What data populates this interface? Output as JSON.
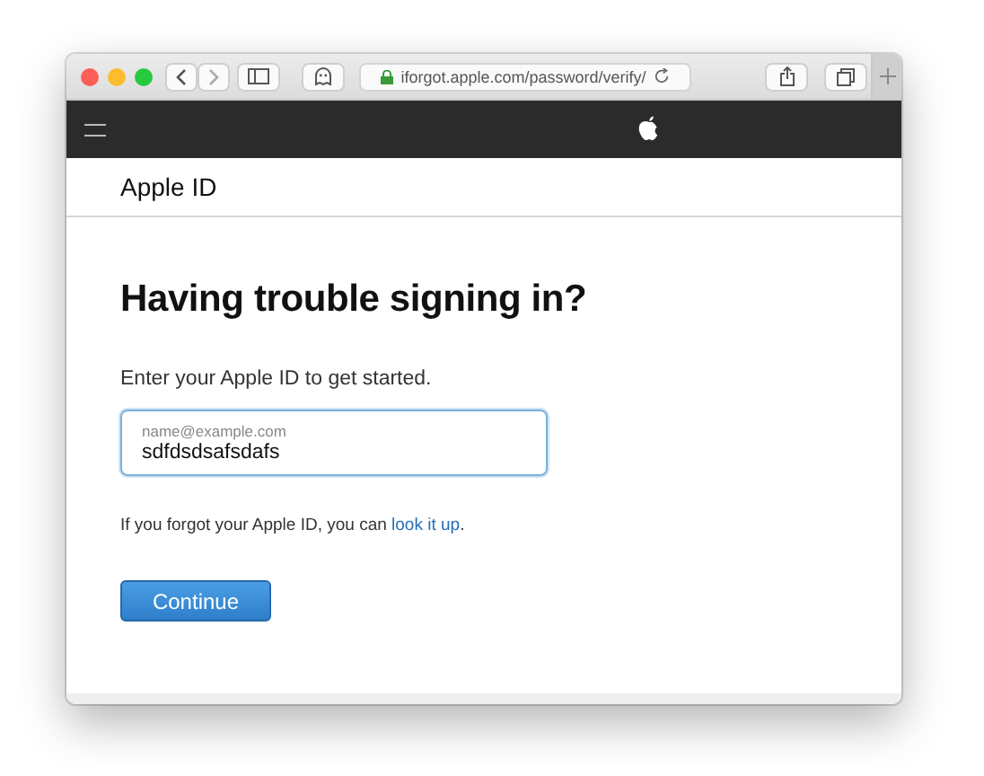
{
  "browser": {
    "url": "iforgot.apple.com/password/verify/"
  },
  "header": {
    "title": "Apple ID"
  },
  "form": {
    "heading": "Having trouble signing in?",
    "prompt": "Enter your Apple ID to get started.",
    "field": {
      "label": "name@example.com",
      "value": "sdfdsdsafsdafs"
    },
    "help": {
      "text_before": "If you forgot your Apple ID, you can ",
      "link": "look it up",
      "text_after": "."
    },
    "button": "Continue"
  }
}
